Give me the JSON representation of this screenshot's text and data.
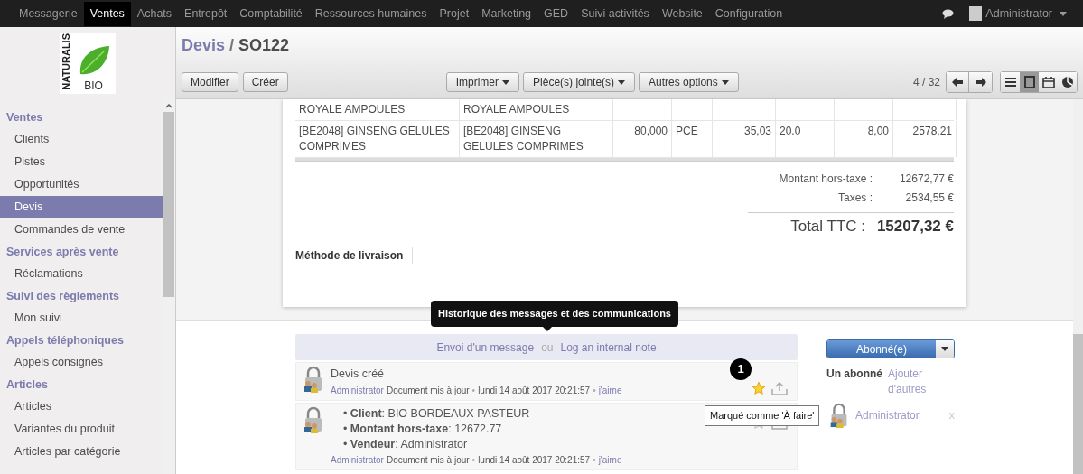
{
  "top_menu": [
    {
      "label": "Messagerie",
      "selected": false
    },
    {
      "label": "Ventes",
      "selected": true
    },
    {
      "label": "Achats",
      "selected": false
    },
    {
      "label": "Entrepôt",
      "selected": false
    },
    {
      "label": "Comptabilité",
      "selected": false
    },
    {
      "label": "Ressources humaines",
      "selected": false
    },
    {
      "label": "Projet",
      "selected": false
    },
    {
      "label": "Marketing",
      "selected": false
    },
    {
      "label": "GED",
      "selected": false
    },
    {
      "label": "Suivi activités",
      "selected": false
    },
    {
      "label": "Website",
      "selected": false
    },
    {
      "label": "Configuration",
      "selected": false
    }
  ],
  "user": {
    "name": "Administrator"
  },
  "logo": {
    "line_1": "NATURALIS",
    "line_2": "BIO"
  },
  "sidebar": {
    "sections": [
      {
        "title": "Ventes",
        "items": [
          {
            "label": "Clients",
            "selected": false
          },
          {
            "label": "Pistes",
            "selected": false
          },
          {
            "label": "Opportunités",
            "selected": false
          },
          {
            "label": "Devis",
            "selected": true
          },
          {
            "label": "Commandes de vente",
            "selected": false
          }
        ]
      },
      {
        "title": "Services après vente",
        "items": [
          {
            "label": "Réclamations",
            "selected": false
          }
        ]
      },
      {
        "title": "Suivi des règlements",
        "items": [
          {
            "label": "Mon suivi",
            "selected": false
          }
        ]
      },
      {
        "title": "Appels téléphoniques",
        "items": [
          {
            "label": "Appels consignés",
            "selected": false
          }
        ]
      },
      {
        "title": "Articles",
        "items": [
          {
            "label": "Articles",
            "selected": false
          },
          {
            "label": "Variantes du produit",
            "selected": false
          },
          {
            "label": "Articles par catégorie",
            "selected": false
          }
        ]
      }
    ]
  },
  "breadcrumb": {
    "parent": "Devis",
    "separator": "/",
    "current": "SO122"
  },
  "buttons": [
    "Modifier",
    "Créer"
  ],
  "dropdowns": [
    "Imprimer",
    "Pièce(s) jointe(s)",
    "Autres options"
  ],
  "pager": "4 / 32",
  "view_switcher": [
    {
      "kind": "list",
      "selected": false
    },
    {
      "kind": "form",
      "selected": true
    },
    {
      "kind": "calendar",
      "selected": false
    },
    {
      "kind": "graph",
      "selected": false
    }
  ],
  "order_lines": [
    {
      "cells": [
        "ROYALE AMPOULES",
        "ROYALE AMPOULES",
        "",
        "",
        "",
        "",
        "",
        ""
      ]
    },
    {
      "cells": [
        "[BE2048] GINSENG GELULES COMPRIMES",
        "[BE2048] GINSENG GELULES COMPRIMES",
        "80,000",
        "PCE",
        "35,03",
        "20.0",
        "8,00",
        "2578,21"
      ]
    }
  ],
  "totals": [
    {
      "label": "Montant hors-taxe :",
      "value": "12672,77 €"
    },
    {
      "label": "Taxes :",
      "value": "2534,55 €"
    }
  ],
  "total": {
    "label": "Total TTC :",
    "value": "15207,32 €"
  },
  "delivery_label": "Méthode de livraison",
  "chatter": {
    "tooltip": "Historique des messages et des communications",
    "compose": {
      "send": "Envoi d'un message",
      "separator": "ou",
      "note": "Log an internal note"
    },
    "badge": "1",
    "star_tooltip": "Marqué comme 'À faire'",
    "messages": [
      {
        "kind": "subject",
        "subject": "Devis créé",
        "author": "Administrator",
        "type": "Document mis à jour",
        "separator": "•",
        "date": "lundi 14 août 2017 20:21:57",
        "like": "j'aime",
        "starred": true
      },
      {
        "kind": "changes",
        "lines": [
          "• **Client**: BIO BORDEAUX PASTEUR",
          "• **Montant hors-taxe**: 12672.77",
          "• **Vendeur**: Administrator"
        ],
        "author": "Administrator",
        "type": "Document mis à jour",
        "separator": "•",
        "date": "lundi 14 août 2017 20:21:57",
        "like": "j'aime",
        "starred": false
      }
    ]
  },
  "followers": {
    "button": "Abonné(e)",
    "count": "Un abonné",
    "add": "Ajouter d'autres",
    "list": [
      {
        "name": "Administrator",
        "remove": "x"
      }
    ]
  }
}
